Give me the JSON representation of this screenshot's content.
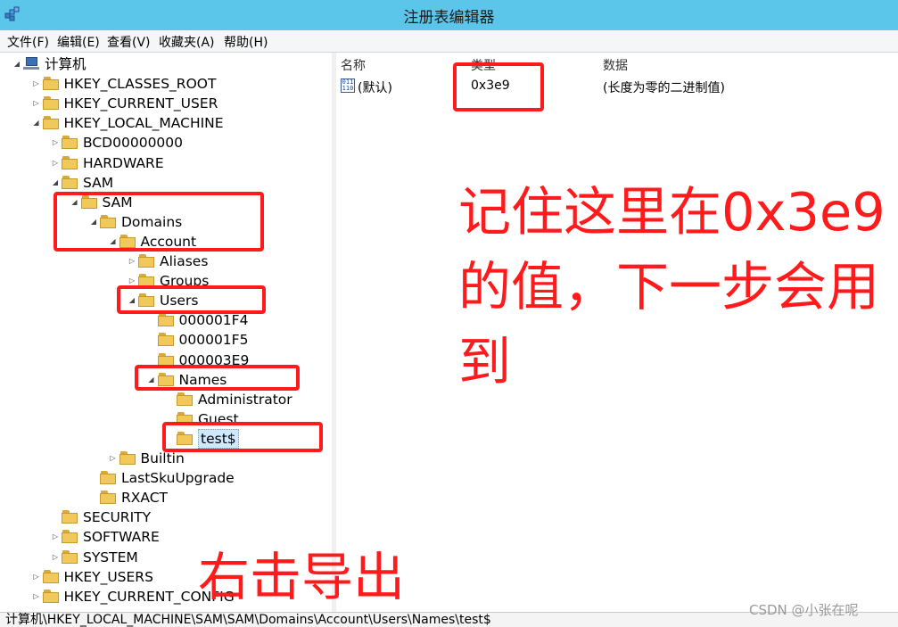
{
  "window": {
    "title": "注册表编辑器",
    "icon": "registry-editor-icon"
  },
  "menu": [
    "文件(F)",
    "编辑(E)",
    "查看(V)",
    "收藏夹(A)",
    "帮助(H)"
  ],
  "tree": {
    "nodes": [
      {
        "label": "计算机",
        "icon": "computer-icon",
        "expander": "◢"
      },
      {
        "label": "HKEY_CLASSES_ROOT",
        "icon": "folder-icon",
        "expander": "▷"
      },
      {
        "label": "HKEY_CURRENT_USER",
        "icon": "folder-icon",
        "expander": "▷"
      },
      {
        "label": "HKEY_LOCAL_MACHINE",
        "icon": "folder-icon",
        "expander": "◢"
      },
      {
        "label": "BCD00000000",
        "icon": "folder-icon",
        "expander": "▷"
      },
      {
        "label": "HARDWARE",
        "icon": "folder-icon",
        "expander": "▷"
      },
      {
        "label": "SAM",
        "icon": "folder-icon",
        "expander": "◢"
      },
      {
        "label": "SAM",
        "icon": "folder-icon",
        "expander": "◢"
      },
      {
        "label": "Domains",
        "icon": "folder-icon",
        "expander": "◢"
      },
      {
        "label": "Account",
        "icon": "folder-icon",
        "expander": "◢"
      },
      {
        "label": "Aliases",
        "icon": "folder-icon",
        "expander": "▷"
      },
      {
        "label": "Groups",
        "icon": "folder-icon",
        "expander": "▷"
      },
      {
        "label": "Users",
        "icon": "folder-icon",
        "expander": "◢"
      },
      {
        "label": "000001F4",
        "icon": "folder-icon",
        "expander": ""
      },
      {
        "label": "000001F5",
        "icon": "folder-icon",
        "expander": ""
      },
      {
        "label": "000003E9",
        "icon": "folder-icon",
        "expander": ""
      },
      {
        "label": "Names",
        "icon": "folder-icon",
        "expander": "◢"
      },
      {
        "label": "Administrator",
        "icon": "folder-icon",
        "expander": ""
      },
      {
        "label": "Guest",
        "icon": "folder-icon",
        "expander": ""
      },
      {
        "label": "test$",
        "icon": "folder-icon",
        "expander": ""
      },
      {
        "label": "Builtin",
        "icon": "folder-icon",
        "expander": "▷"
      },
      {
        "label": "LastSkuUpgrade",
        "icon": "folder-icon",
        "expander": ""
      },
      {
        "label": "RXACT",
        "icon": "folder-icon",
        "expander": ""
      },
      {
        "label": "SECURITY",
        "icon": "folder-icon",
        "expander": ""
      },
      {
        "label": "SOFTWARE",
        "icon": "folder-icon",
        "expander": "▷"
      },
      {
        "label": "SYSTEM",
        "icon": "folder-icon",
        "expander": "▷"
      },
      {
        "label": "HKEY_USERS",
        "icon": "folder-icon",
        "expander": "▷"
      },
      {
        "label": "HKEY_CURRENT_CONFIG",
        "icon": "folder-icon",
        "expander": "▷"
      }
    ],
    "selected": "test$"
  },
  "values": {
    "columns": [
      "名称",
      "类型",
      "数据"
    ],
    "rows": [
      {
        "name": "(默认)",
        "type": "0x3e9",
        "data": "(长度为零的二进制值)",
        "icon": "binary-value-icon"
      }
    ]
  },
  "status_bar": {
    "path": "计算机\\HKEY_LOCAL_MACHINE\\SAM\\SAM\\Domains\\Account\\Users\\Names\\test$"
  },
  "annotations": {
    "main": "记住这里在0x3e9的值，下一步会用到",
    "bottom": "右击导出",
    "color": "#ff1b1b"
  },
  "watermark": "CSDN @小张在呢",
  "colors": {
    "titlebar": "#5bc6ea",
    "folder": "#f1c95a",
    "annotation": "#ff1b1b"
  }
}
